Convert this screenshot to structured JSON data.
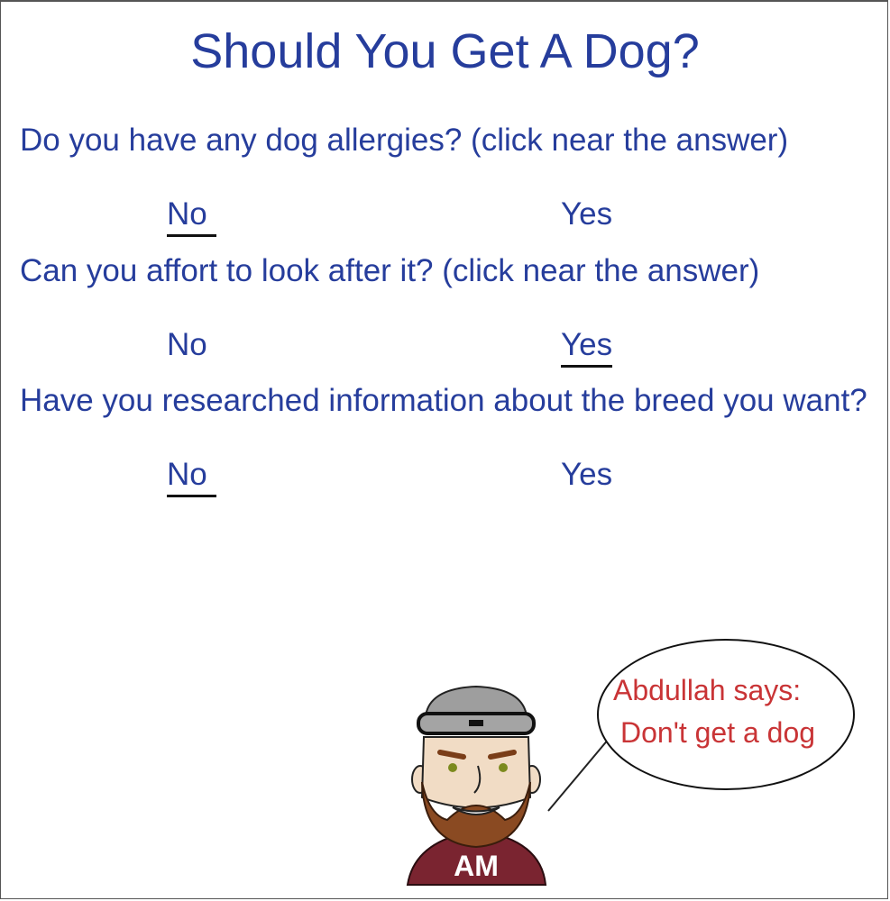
{
  "page": {
    "title": "Should You Get A Dog?"
  },
  "questions": [
    {
      "text": "Do you have any dog allergies? (click near the answer)",
      "no_label": "No",
      "yes_label": "Yes",
      "selected": "No"
    },
    {
      "text": "Can you affort to look after it? (click near the answer)",
      "no_label": "No",
      "yes_label": "Yes",
      "selected": "Yes"
    },
    {
      "text": "Have you researched information about the breed you want?",
      "no_label": "No",
      "yes_label": "Yes",
      "selected": "No"
    }
  ],
  "speech": {
    "line1": "Abdullah says:",
    "line2": "Don't get a dog"
  },
  "avatar": {
    "initials": "AM"
  },
  "colors": {
    "heading": "#263d9c",
    "speech_text": "#c93436",
    "shirt": "#7a2430",
    "beard": "#8a4a22",
    "hat": "#9e9e9e"
  }
}
